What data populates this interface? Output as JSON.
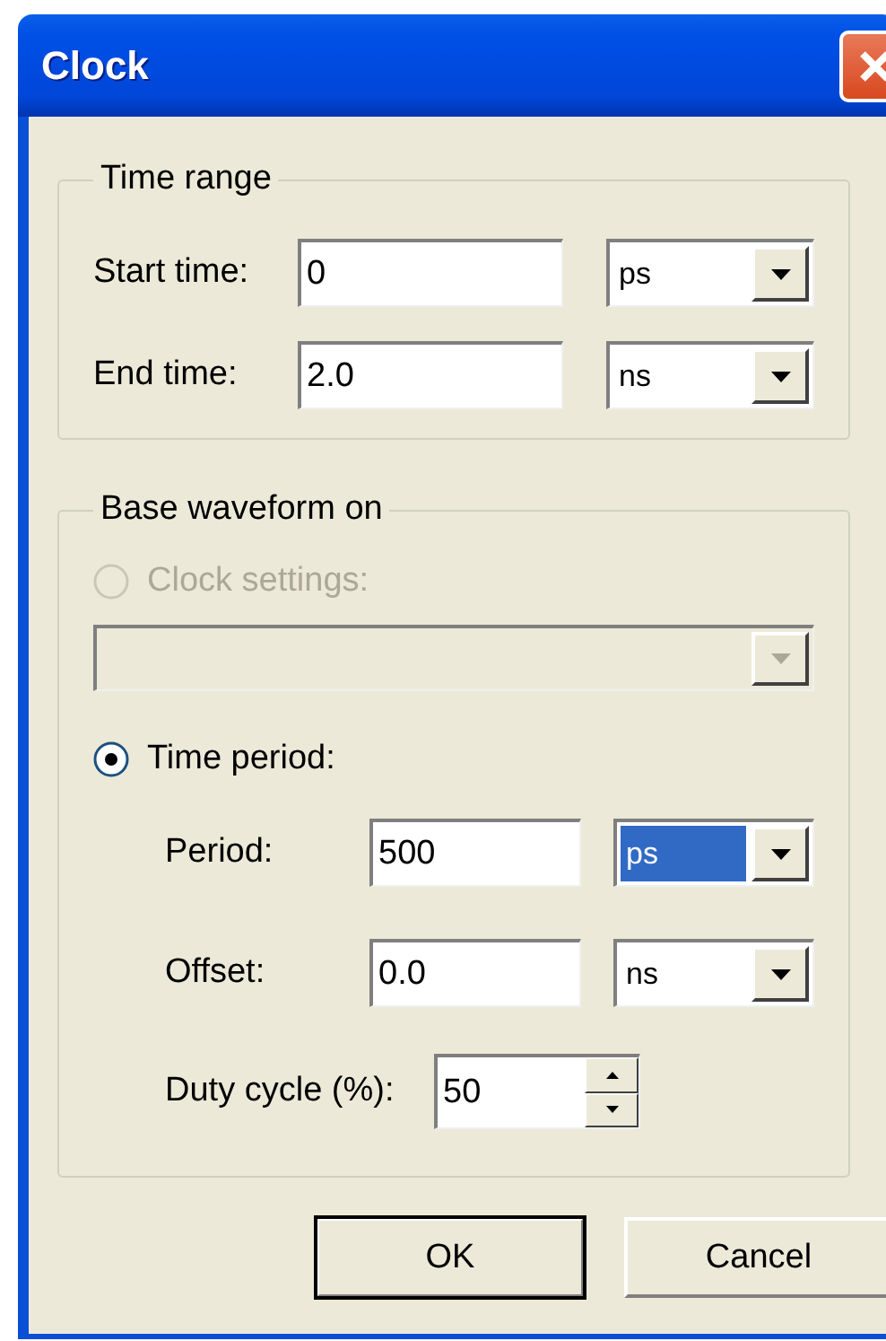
{
  "window": {
    "title": "Clock"
  },
  "time_range": {
    "title": "Time range",
    "rows": [
      {
        "label": "Start time:",
        "value": "0",
        "unit": "ps",
        "focused": false
      },
      {
        "label": "End time:",
        "value": "2.0",
        "unit": "ns",
        "focused": false
      }
    ]
  },
  "base_waveform": {
    "title": "Base waveform on",
    "options": [
      {
        "label": "Clock settings:",
        "selected": false,
        "disabled": true
      },
      {
        "label": "Time period:",
        "selected": true,
        "disabled": false
      }
    ],
    "clock_settings_dropdown": {
      "disabled": true
    },
    "rows": [
      {
        "label": "Period:",
        "value": "500",
        "unit": "ps",
        "focused": true
      },
      {
        "label": "Offset:",
        "value": "0.0",
        "unit": "ns",
        "focused": false
      }
    ],
    "duty_cycle": {
      "label": "Duty cycle (%):",
      "value": "50"
    }
  },
  "buttons": [
    {
      "label": "OK",
      "default": true
    },
    {
      "label": "Cancel",
      "default": false
    }
  ]
}
